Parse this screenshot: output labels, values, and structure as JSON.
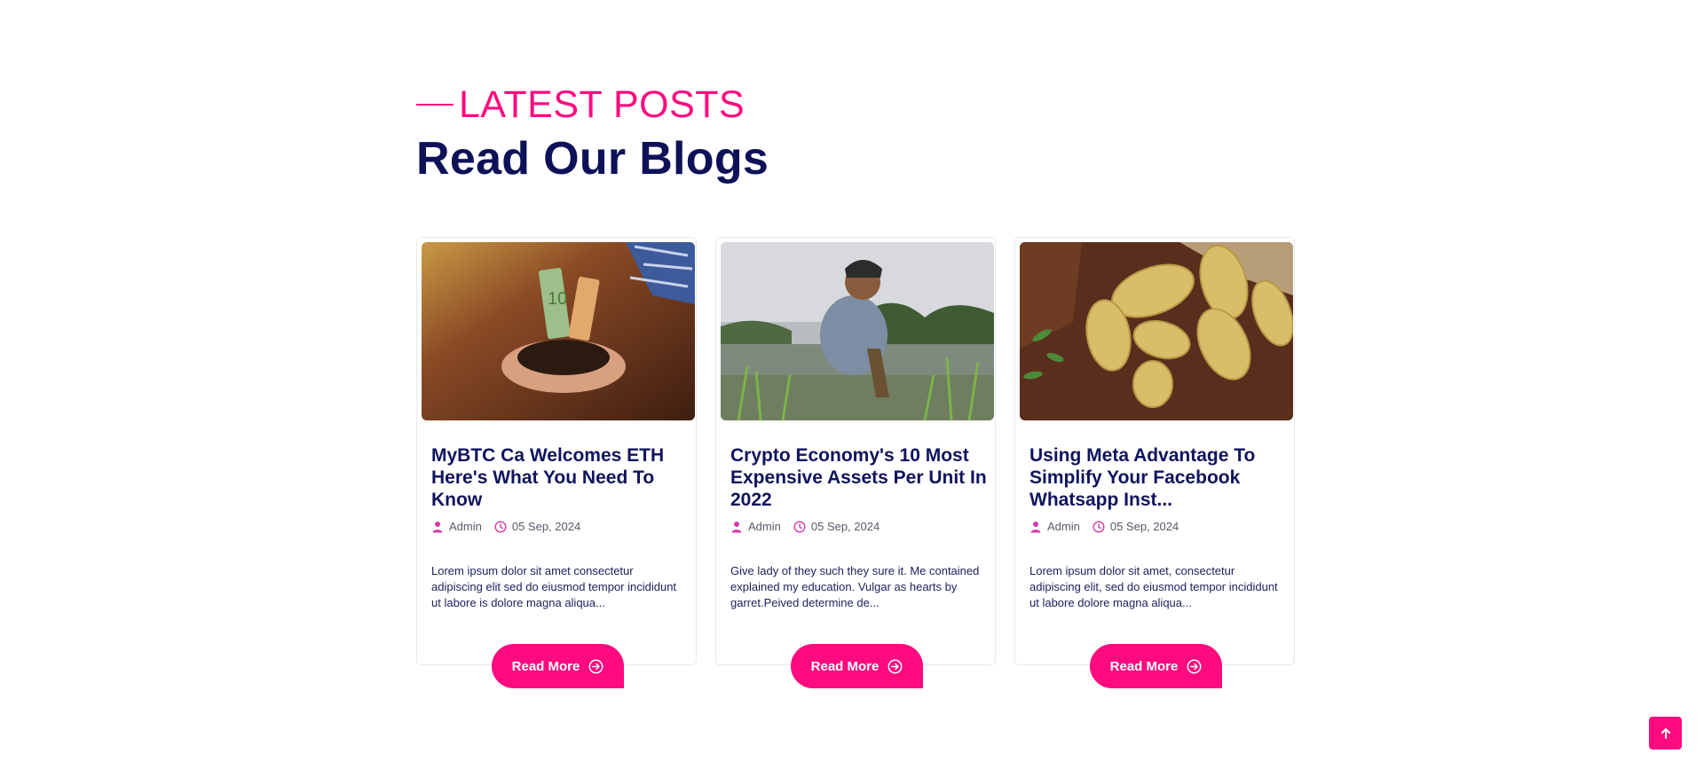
{
  "section": {
    "eyebrow": "LATEST POSTS",
    "heading": "Read Our Blogs"
  },
  "posts": [
    {
      "image_alt": "hands holding soil with money",
      "title": "MyBTC Ca Welcomes ETH Here's What You Need To Know",
      "author": "Admin",
      "date": "05 Sep, 2024",
      "excerpt": "Lorem ipsum dolor sit amet consectetur adipiscing elit sed do eiusmod tempor incididunt ut labore is dolore magna aliqua...",
      "button": "Read More"
    },
    {
      "image_alt": "farmer planting rice",
      "title": "Crypto Economy's 10 Most Expensive Assets Per Unit In 2022",
      "author": "Admin",
      "date": "05 Sep, 2024",
      "excerpt": "Give lady of they such they sure it. Me contained explained my education. Vulgar as hearts by garret.Peived determine de...",
      "button": "Read More"
    },
    {
      "image_alt": "potatoes spilling from sack",
      "title": "Using Meta Advantage To Simplify Your Facebook Whatsapp Inst...",
      "author": "Admin",
      "date": "05 Sep, 2024",
      "excerpt": "Lorem ipsum dolor sit amet, consectetur adipiscing elit, sed do eiusmod tempor incididunt ut labore dolore magna aliqua...",
      "button": "Read More"
    }
  ],
  "colors": {
    "accent": "#ff0a7f",
    "heading": "#0d1158",
    "title": "#10145e"
  },
  "icons": {
    "author": "user-icon",
    "date": "clock-icon",
    "button": "arrow-circle-right-icon",
    "to_top": "arrow-up-icon"
  }
}
